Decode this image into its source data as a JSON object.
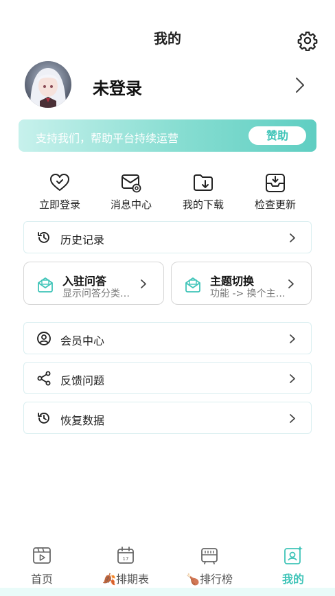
{
  "header": {
    "title": "我的"
  },
  "profile": {
    "name": "未登录"
  },
  "banner": {
    "text": "支持我们，帮助平台持续运营",
    "button": "赞助"
  },
  "quick_actions": [
    {
      "label": "立即登录",
      "icon": "heart-icon"
    },
    {
      "label": "消息中心",
      "icon": "mail-icon"
    },
    {
      "label": "我的下载",
      "icon": "folder-download-icon"
    },
    {
      "label": "检查更新",
      "icon": "inbox-download-icon"
    }
  ],
  "menu": {
    "history": "历史记录",
    "member": "会员中心",
    "feedback": "反馈问题",
    "restore": "恢复数据"
  },
  "cards": [
    {
      "title": "入驻问答",
      "subtitle": "显示问答分类…"
    },
    {
      "title": "主题切换",
      "subtitle": "功能 -> 换个主…"
    }
  ],
  "tabs": [
    {
      "label": "首页",
      "emoji": ""
    },
    {
      "label": "排期表",
      "emoji": "🍂"
    },
    {
      "label": "排行榜",
      "emoji": "🍗"
    },
    {
      "label": "我的",
      "emoji": ""
    }
  ],
  "colors": {
    "accent": "#3fc4b8",
    "banner_start": "#c7f1ec",
    "banner_end": "#5fcec2"
  }
}
